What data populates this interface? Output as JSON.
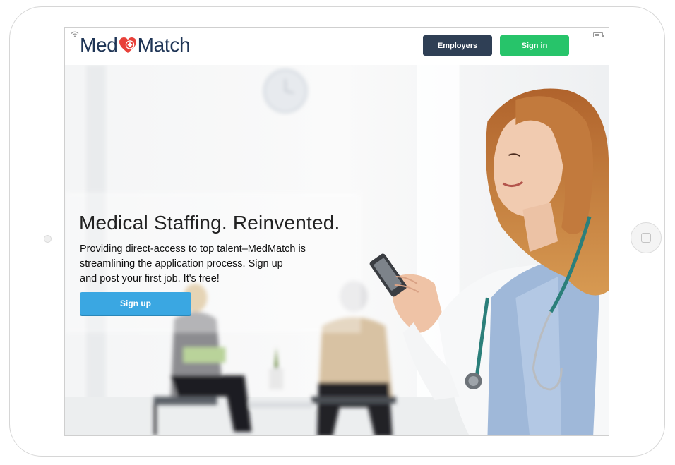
{
  "header": {
    "logo_part1": "Med",
    "logo_part2": "Match",
    "employers_label": "Employers",
    "signin_label": "Sign in"
  },
  "hero": {
    "headline": "Medical Staffing. Reinvented.",
    "subtext_line1": "Providing direct-access to top talent–MedMatch is",
    "subtext_line2": "streamlining the application process. Sign up",
    "subtext_line3": "and post your first job. It's free!",
    "signup_label": "Sign up"
  },
  "colors": {
    "brand_navy": "#1f3556",
    "brand_red": "#e8413a",
    "employers_button": "#2f3f55",
    "signin_button": "#27c46a",
    "signup_button": "#3aa7e2"
  }
}
